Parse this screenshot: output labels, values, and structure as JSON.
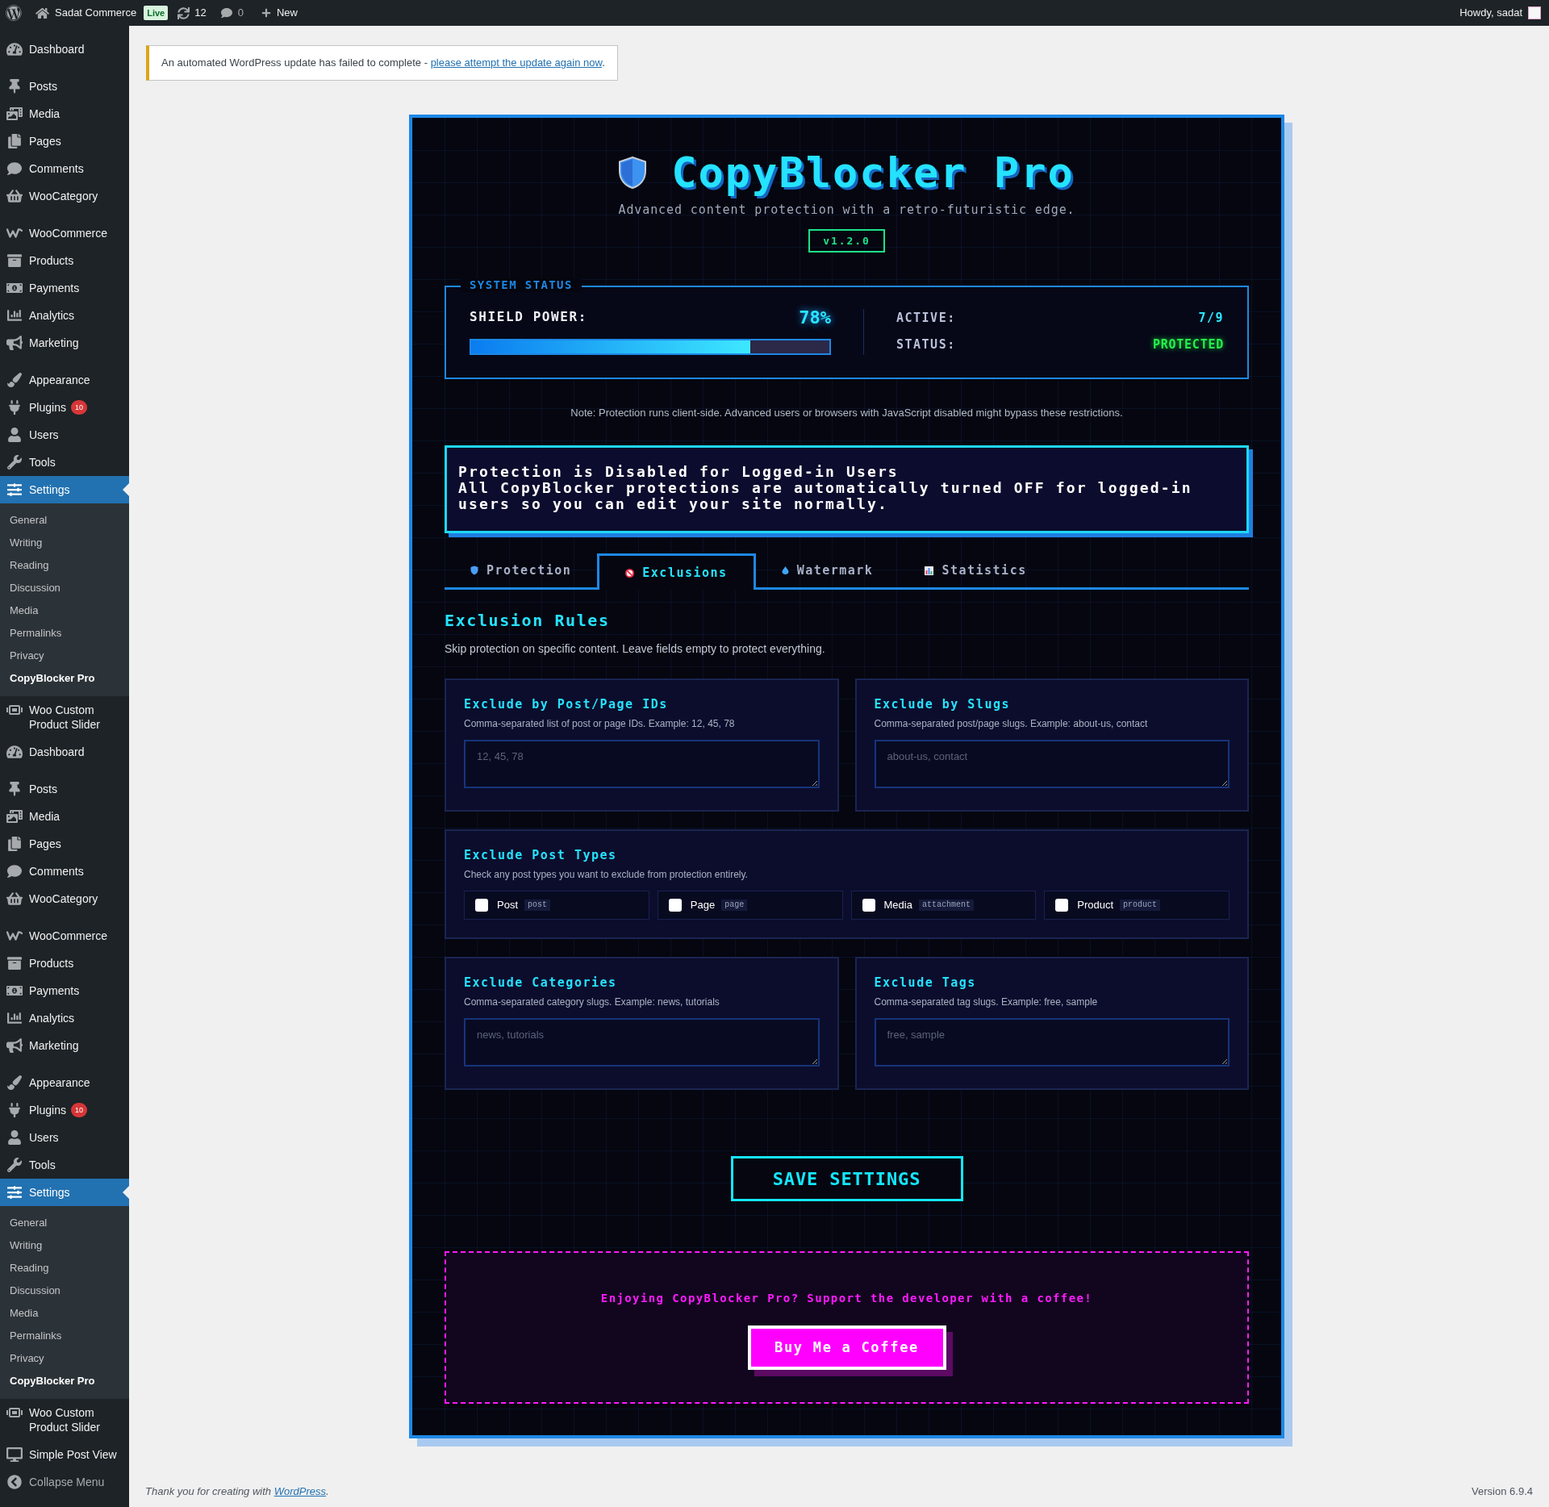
{
  "admin_bar": {
    "site_name": "Sadat Commerce",
    "live_badge": "Live",
    "updates_count": "12",
    "comments_count": "0",
    "new_label": "New",
    "greeting": "Howdy, sadat"
  },
  "sidebar": {
    "groups": [
      {
        "items": [
          {
            "label": "Dashboard",
            "selected": false
          }
        ]
      },
      {
        "items": [
          {
            "label": "Posts",
            "selected": false
          },
          {
            "label": "Media",
            "selected": false
          },
          {
            "label": "Pages",
            "selected": false
          },
          {
            "label": "Comments",
            "selected": false
          },
          {
            "label": "WooCategory",
            "selected": false
          }
        ]
      },
      {
        "items": [
          {
            "label": "WooCommerce",
            "selected": false
          },
          {
            "label": "Products",
            "selected": false
          },
          {
            "label": "Payments",
            "selected": false
          },
          {
            "label": "Analytics",
            "selected": false
          },
          {
            "label": "Marketing",
            "selected": false
          }
        ]
      },
      {
        "items": [
          {
            "label": "Appearance",
            "selected": false
          },
          {
            "label": "Plugins",
            "selected": false,
            "badge": "10"
          },
          {
            "label": "Users",
            "selected": false
          },
          {
            "label": "Tools",
            "selected": false
          },
          {
            "label": "Settings",
            "selected": true,
            "children": [
              {
                "label": "General",
                "selected": false
              },
              {
                "label": "Writing",
                "selected": false
              },
              {
                "label": "Reading",
                "selected": false
              },
              {
                "label": "Discussion",
                "selected": false
              },
              {
                "label": "Media",
                "selected": false
              },
              {
                "label": "Permalinks",
                "selected": false
              },
              {
                "label": "Privacy",
                "selected": false
              },
              {
                "label": "CopyBlocker Pro",
                "selected": true
              }
            ]
          },
          {
            "label": "Woo Custom Product Slider",
            "selected": false
          },
          {
            "label": "Dashboard",
            "selected": false
          }
        ]
      },
      {
        "items": [
          {
            "label": "Posts",
            "selected": false
          },
          {
            "label": "Media",
            "selected": false
          },
          {
            "label": "Pages",
            "selected": false
          },
          {
            "label": "Comments",
            "selected": false
          },
          {
            "label": "WooCategory",
            "selected": false
          }
        ]
      },
      {
        "items": [
          {
            "label": "WooCommerce",
            "selected": false
          },
          {
            "label": "Products",
            "selected": false
          },
          {
            "label": "Payments",
            "selected": false
          },
          {
            "label": "Analytics",
            "selected": false
          },
          {
            "label": "Marketing",
            "selected": false
          }
        ]
      },
      {
        "items": [
          {
            "label": "Appearance",
            "selected": false
          },
          {
            "label": "Plugins",
            "selected": false,
            "badge": "10"
          },
          {
            "label": "Users",
            "selected": false
          },
          {
            "label": "Tools",
            "selected": false
          },
          {
            "label": "Settings",
            "selected": true,
            "children": [
              {
                "label": "General",
                "selected": false
              },
              {
                "label": "Writing",
                "selected": false
              },
              {
                "label": "Reading",
                "selected": false
              },
              {
                "label": "Discussion",
                "selected": false
              },
              {
                "label": "Media",
                "selected": false
              },
              {
                "label": "Permalinks",
                "selected": false
              },
              {
                "label": "Privacy",
                "selected": false
              },
              {
                "label": "CopyBlocker Pro",
                "selected": true
              }
            ]
          },
          {
            "label": "Woo Custom Product Slider",
            "selected": false
          },
          {
            "label": "Simple Post View",
            "selected": false
          }
        ]
      }
    ],
    "collapse_label": "Collapse Menu"
  },
  "notice": {
    "text": "An automated WordPress update has failed to complete - ",
    "link": "please attempt the update again now",
    "after_link": "."
  },
  "header": {
    "title": "CopyBlocker Pro",
    "subtitle": "Advanced content protection with a retro-futuristic edge.",
    "version": "v1.2.0"
  },
  "system_status": {
    "legend": "SYSTEM STATUS",
    "shield_label": "SHIELD POWER:",
    "shield_value": "78%",
    "level": 0.78,
    "active_label": "ACTIVE:",
    "active_value": "7/9",
    "status_label": "STATUS:",
    "status_value": "PROTECTED"
  },
  "note": "Note: Protection runs client-side. Advanced users or browsers with JavaScript disabled might bypass these restrictions.",
  "logged_in_notice": {
    "title": "Protection is Disabled for Logged-in Users",
    "body": "All CopyBlocker protections are automatically turned OFF for logged-in users so you can edit your site normally."
  },
  "tabs": [
    {
      "label": "Protection",
      "selected": false
    },
    {
      "label": "Exclusions",
      "selected": true
    },
    {
      "label": "Watermark",
      "selected": false
    },
    {
      "label": "Statistics",
      "selected": false
    }
  ],
  "section": {
    "title": "Exclusion Rules",
    "description": "Skip protection on specific content. Leave fields empty to protect everything."
  },
  "cards": [
    {
      "kind": "textarea",
      "title": "Exclude by Post/Page IDs",
      "description": "Comma-separated list of post or page IDs. Example: 12, 45, 78",
      "placeholder": "12, 45, 78"
    },
    {
      "kind": "textarea",
      "title": "Exclude by Slugs",
      "description": "Comma-separated post/page slugs. Example: about-us, contact",
      "placeholder": "about-us, contact"
    },
    {
      "kind": "checkboxes",
      "title": "Exclude Post Types",
      "description": "Check any post types you want to exclude from protection entirely.",
      "options": [
        {
          "label": "Post",
          "slug": "post",
          "checked": false
        },
        {
          "label": "Page",
          "slug": "page",
          "checked": false
        },
        {
          "label": "Media",
          "slug": "attachment",
          "checked": false
        },
        {
          "label": "Product",
          "slug": "product",
          "checked": false
        }
      ]
    },
    {
      "kind": "textarea",
      "title": "Exclude Categories",
      "description": "Comma-separated category slugs. Example: news, tutorials",
      "placeholder": "news, tutorials"
    },
    {
      "kind": "textarea",
      "title": "Exclude Tags",
      "description": "Comma-separated tag slugs. Example: free, sample",
      "placeholder": "free, sample"
    }
  ],
  "save_button": "SAVE SETTINGS",
  "support": {
    "text": "Enjoying CopyBlocker Pro? Support the developer with a coffee!",
    "button": "Buy Me a Coffee"
  },
  "footer": {
    "text": "Thank you for creating with ",
    "link": "WordPress",
    "after_link": ".",
    "version": "Version 6.9.4"
  }
}
